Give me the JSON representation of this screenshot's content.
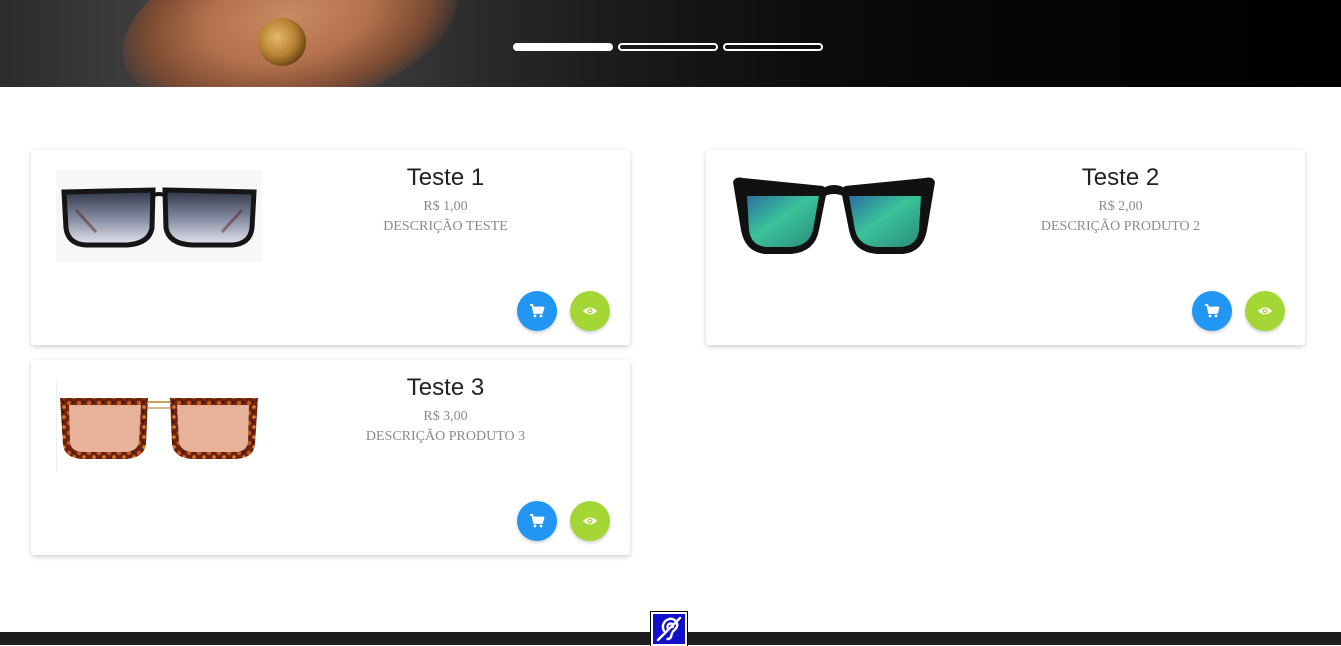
{
  "hero": {
    "slides": [
      {
        "active": true
      },
      {
        "active": false
      },
      {
        "active": false
      }
    ]
  },
  "products": [
    {
      "title": "Teste 1",
      "price": "R$ 1,00",
      "description": "DESCRIÇÃO TESTE",
      "image": "black-gradient-sunglasses"
    },
    {
      "title": "Teste 2",
      "price": "R$ 2,00",
      "description": "DESCRIÇÃO PRODUTO 2",
      "image": "green-mirror-sport-sunglasses"
    },
    {
      "title": "Teste 3",
      "price": "R$ 3,00",
      "description": "DESCRIÇÃO PRODUTO 3",
      "image": "tortoise-sunglasses"
    }
  ],
  "buttons": {
    "cart_icon": "shopping-cart-icon",
    "view_icon": "eye-icon",
    "cart_color": "#2196f3",
    "view_color": "#a4d636"
  },
  "accessibility": {
    "icon": "hearing-assistance-icon",
    "color": "#1010c8"
  },
  "footer": {
    "color": "#1d1d1d"
  }
}
